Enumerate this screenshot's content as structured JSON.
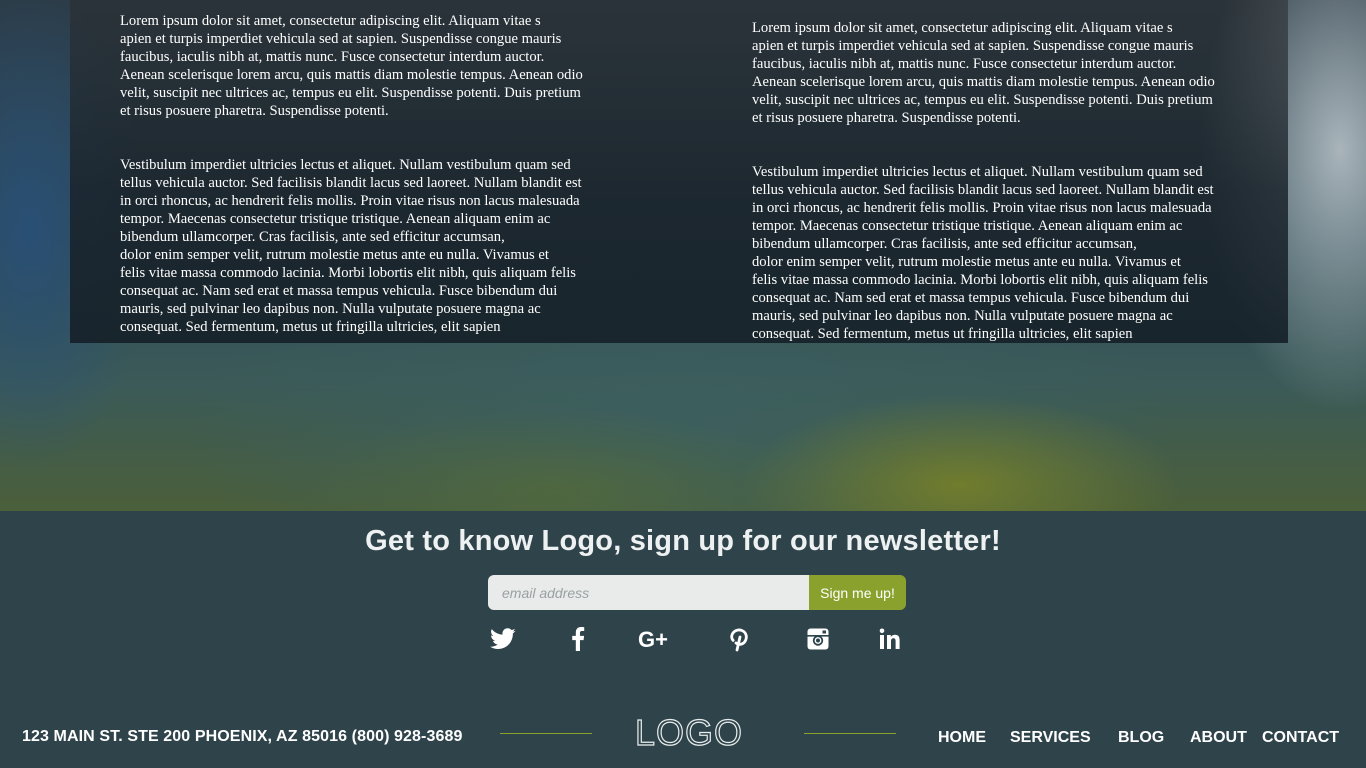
{
  "article": {
    "left": {
      "para1": "Lorem ipsum dolor sit amet, consectetur adipiscing elit. Aliquam vitae s\napien et turpis imperdiet vehicula sed at sapien. Suspendisse congue mauris\nfaucibus, iaculis nibh at, mattis nunc. Fusce consectetur interdum auctor.\nAenean scelerisque lorem arcu, quis mattis diam molestie tempus. Aenean odio\nvelit, suscipit nec ultrices ac, tempus eu elit. Suspendisse potenti. Duis pretium\net risus posuere pharetra. Suspendisse potenti.",
      "para2": "Vestibulum imperdiet ultricies lectus et aliquet. Nullam vestibulum quam sed\ntellus vehicula auctor. Sed facilisis blandit lacus sed laoreet. Nullam blandit est\nin orci rhoncus, ac hendrerit felis mollis. Proin vitae risus non lacus malesuada\ntempor. Maecenas consectetur tristique tristique. Aenean aliquam enim ac\nbibendum ullamcorper. Cras facilisis, ante sed efficitur accumsan,\ndolor enim semper velit, rutrum molestie metus ante eu nulla. Vivamus et\nfelis vitae massa commodo lacinia. Morbi lobortis elit nibh, quis aliquam felis\nconsequat ac. Nam sed erat et massa tempus vehicula. Fusce bibendum dui\nmauris, sed pulvinar leo dapibus non. Nulla vulputate posuere magna ac\nconsequat. Sed fermentum, metus ut fringilla ultricies, elit sapien"
    },
    "right": {
      "para1": "Lorem ipsum dolor sit amet, consectetur adipiscing elit. Aliquam vitae s\napien et turpis imperdiet vehicula sed at sapien. Suspendisse congue mauris\nfaucibus, iaculis nibh at, mattis nunc. Fusce consectetur interdum auctor.\nAenean scelerisque lorem arcu, quis mattis diam molestie tempus. Aenean odio\nvelit, suscipit nec ultrices ac, tempus eu elit. Suspendisse potenti. Duis pretium\net risus posuere pharetra. Suspendisse potenti.",
      "para2": "Vestibulum imperdiet ultricies lectus et aliquet. Nullam vestibulum quam sed\ntellus vehicula auctor. Sed facilisis blandit lacus sed laoreet. Nullam blandit est\nin orci rhoncus, ac hendrerit felis mollis. Proin vitae risus non lacus malesuada\ntempor. Maecenas consectetur tristique tristique. Aenean aliquam enim ac\nbibendum ullamcorper. Cras facilisis, ante sed efficitur accumsan,\ndolor enim semper velit, rutrum molestie metus ante eu nulla. Vivamus et\nfelis vitae massa commodo lacinia. Morbi lobortis elit nibh, quis aliquam felis\nconsequat ac. Nam sed erat et massa tempus vehicula. Fusce bibendum dui\nmauris, sed pulvinar leo dapibus non. Nulla vulputate posuere magna ac\nconsequat. Sed fermentum, metus ut fringilla ultricies, elit sapien"
    }
  },
  "newsletter": {
    "title": "Get to know Logo, sign up for our newsletter!",
    "email_placeholder": "email address",
    "button_label": "Sign me up!"
  },
  "social": {
    "icons": [
      "twitter-icon",
      "facebook-icon",
      "google-plus-icon",
      "pinterest-icon",
      "instagram-icon",
      "linkedin-icon"
    ]
  },
  "footer": {
    "address": "123 MAIN ST. STE 200 PHOENIX, AZ 85016 (800) 928-3689",
    "logo_text": "LOGO",
    "nav": [
      "HOME",
      "SERVICES",
      "BLOG",
      "ABOUT",
      "CONTACT"
    ]
  },
  "colors": {
    "accent": "#8aa22d",
    "footer_bg": "#2f434b",
    "input_bg": "#e8ebea"
  }
}
